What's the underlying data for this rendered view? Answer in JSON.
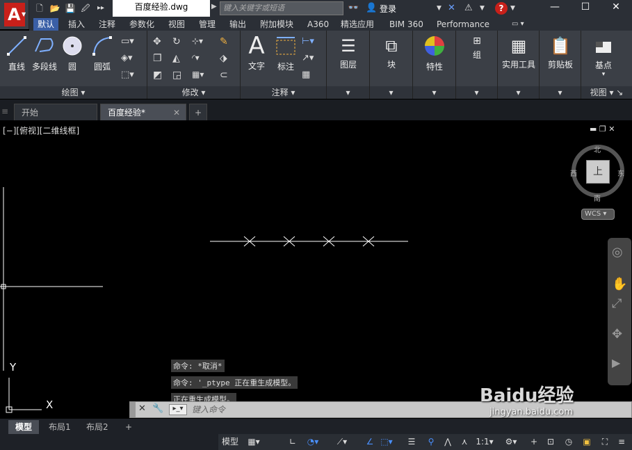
{
  "app": {
    "logo_letter": "A",
    "document_title": "百度经验.dwg",
    "search_placeholder": "键入关键字或短语",
    "login_label": "登录"
  },
  "ribbon_tabs": [
    "默认",
    "插入",
    "注释",
    "参数化",
    "视图",
    "管理",
    "输出",
    "附加模块",
    "A360",
    "精选应用",
    "BIM 360",
    "Performance"
  ],
  "panels": {
    "draw": {
      "title": "绘图",
      "tools": [
        "直线",
        "多段线",
        "圆",
        "圆弧"
      ]
    },
    "modify": {
      "title": "修改"
    },
    "annotate": {
      "title": "注释",
      "tools": [
        "文字",
        "标注"
      ]
    },
    "layers": {
      "label": "图层"
    },
    "block": {
      "label": "块"
    },
    "properties": {
      "label": "特性"
    },
    "group": {
      "label": "组"
    },
    "utilities": {
      "label": "实用工具"
    },
    "clipboard": {
      "label": "剪贴板"
    },
    "basepoint": {
      "label": "基点"
    },
    "view": {
      "title": "视图"
    }
  },
  "file_tabs": [
    "开始",
    "百度经验*"
  ],
  "viewport": {
    "label": "[−][俯视][二维线框]",
    "compass": {
      "north": "北",
      "south": "南",
      "east": "东",
      "west": "西",
      "top": "上"
    },
    "wcs_label": "WCS",
    "axis_y": "Y",
    "axis_x": "X"
  },
  "command_history": [
    "命令: *取消*",
    "命令: '_ptype 正在重生成模型。",
    "正在重生成模型。"
  ],
  "command_placeholder": "键入命令",
  "layout_tabs": [
    "模型",
    "布局1",
    "布局2"
  ],
  "status": {
    "model": "模型",
    "scale": "1:1"
  },
  "watermark": {
    "brand": "Baidu经验",
    "url": "jingyan.baidu.com"
  },
  "colors": {
    "accent": "#3a5fa6",
    "logo": "#c8201a",
    "background": "#000000"
  }
}
